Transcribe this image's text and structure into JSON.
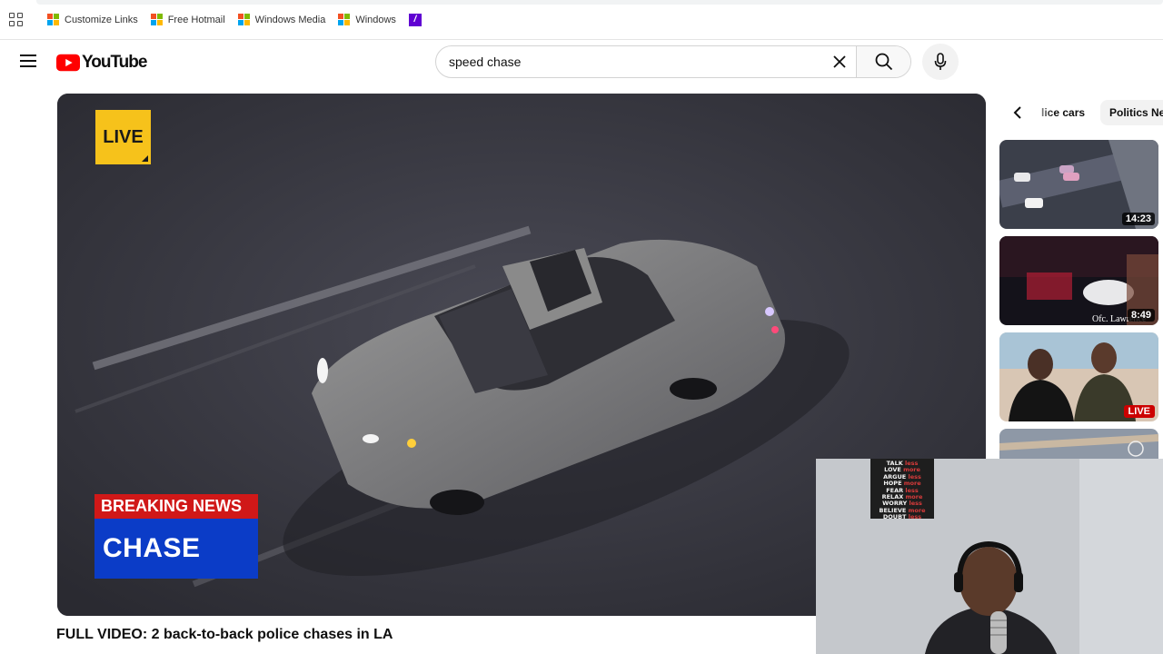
{
  "bookmarks": {
    "items": [
      {
        "label": "Customize Links",
        "icon": "microsoft-icon"
      },
      {
        "label": "Free Hotmail",
        "icon": "microsoft-icon"
      },
      {
        "label": "Windows Media",
        "icon": "microsoft-icon"
      },
      {
        "label": "Windows",
        "icon": "microsoft-icon"
      }
    ],
    "extra_icon": "yahoo-icon"
  },
  "header": {
    "logo_text": "YouTube",
    "search_value": "speed chase",
    "brand_color": "#ff0000"
  },
  "player": {
    "live_bug": "LIVE",
    "lower_third_top": "BREAKING NEWS",
    "lower_third_bottom": "CHASE"
  },
  "video": {
    "title": "FULL VIDEO: 2 back-to-back police chases in LA"
  },
  "chips": [
    "lice cars",
    "Politics Ne"
  ],
  "related": [
    {
      "duration": "14:23"
    },
    {
      "duration": "8:49",
      "caption": "Ofc. Lawrence"
    },
    {
      "badge": "LIVE"
    },
    {
      "badge": ""
    }
  ],
  "webcam": {
    "poster_lines": [
      [
        "TALK",
        "less"
      ],
      [
        "LOVE",
        "more"
      ],
      [
        "ARGUE",
        "less"
      ],
      [
        "HOPE",
        "more"
      ],
      [
        "FEAR",
        "less"
      ],
      [
        "RELAX",
        "more"
      ],
      [
        "WORRY",
        "less"
      ],
      [
        "BELIEVE",
        "more"
      ],
      [
        "DOUBT",
        "less"
      ]
    ]
  }
}
